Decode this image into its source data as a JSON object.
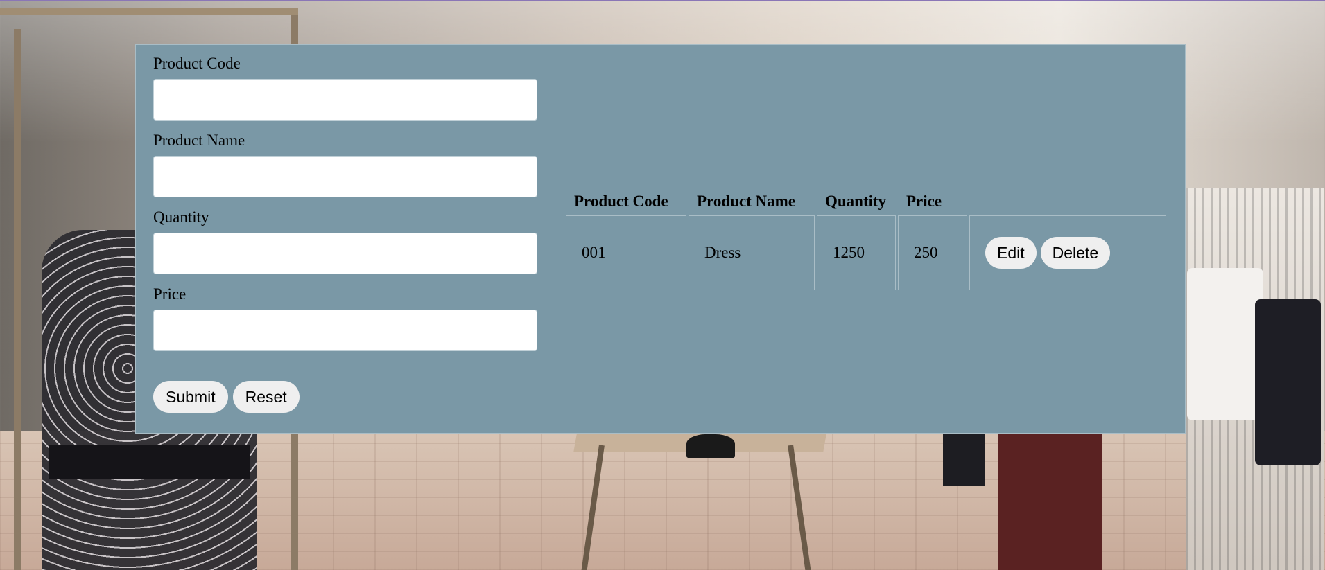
{
  "form": {
    "fields": [
      {
        "label": "Product Code",
        "value": "",
        "placeholder": ""
      },
      {
        "label": "Product Name",
        "value": "",
        "placeholder": ""
      },
      {
        "label": "Quantity",
        "value": "",
        "placeholder": ""
      },
      {
        "label": "Price",
        "value": "",
        "placeholder": ""
      }
    ],
    "submit_label": "Submit",
    "reset_label": "Reset"
  },
  "table": {
    "headers": [
      "Product Code",
      "Product Name",
      "Quantity",
      "Price"
    ],
    "rows": [
      {
        "code": "001",
        "name": "Dress",
        "quantity": "1250",
        "price": "250",
        "edit_label": "Edit",
        "delete_label": "Delete"
      }
    ]
  },
  "colors": {
    "panel_background": "#7a98a6",
    "button_background": "#efefef",
    "input_background": "#ffffff"
  }
}
